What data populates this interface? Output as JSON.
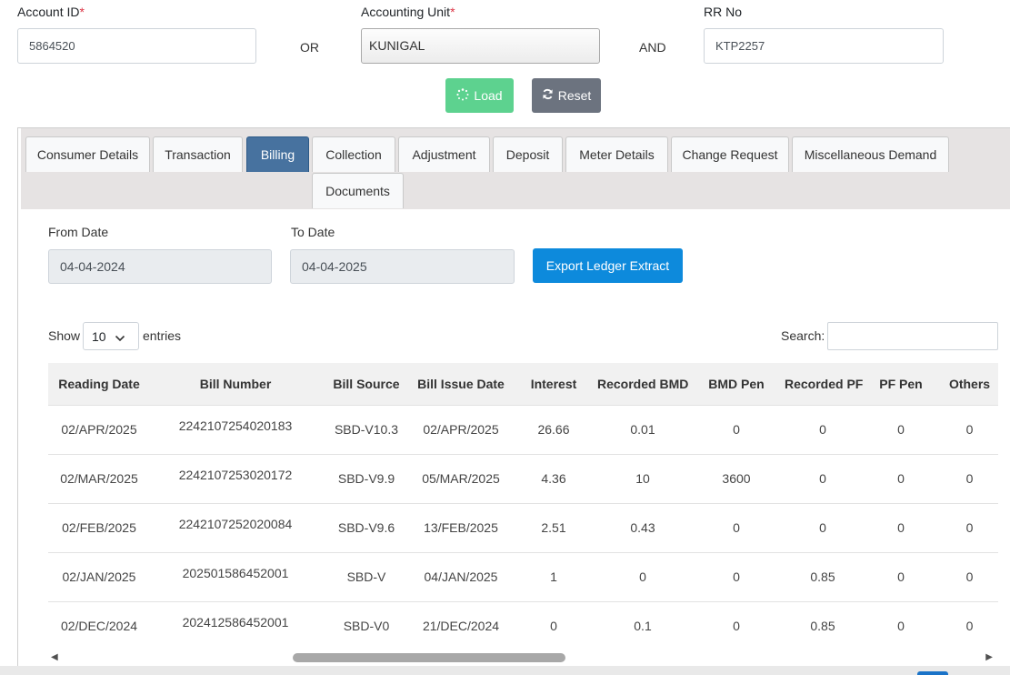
{
  "search_form": {
    "account_id_label": "Account ID",
    "account_id_value": "5864520",
    "or_text": "OR",
    "accounting_unit_label": "Accounting Unit",
    "accounting_unit_value": "KUNIGAL",
    "and_text": "AND",
    "rr_no_label": "RR No",
    "rr_no_value": "KTP2257",
    "required_mark": "*",
    "load_label": "Load",
    "reset_label": "Reset"
  },
  "tabs": [
    {
      "label": "Consumer Details",
      "active": false
    },
    {
      "label": "Transaction",
      "active": false
    },
    {
      "label": "Billing",
      "active": true
    },
    {
      "label": "Collection",
      "active": false
    },
    {
      "label": "Adjustment",
      "active": false
    },
    {
      "label": "Deposit",
      "active": false
    },
    {
      "label": "Meter Details",
      "active": false
    },
    {
      "label": "Change Request",
      "active": false
    },
    {
      "label": "Miscellaneous Demand",
      "active": false
    },
    {
      "label": "Documents",
      "active": false
    }
  ],
  "billing": {
    "from_date_label": "From Date",
    "from_date_value": "04-04-2024",
    "to_date_label": "To Date",
    "to_date_value": "04-04-2025",
    "export_label": "Export Ledger Extract",
    "show_label": "Show",
    "entries_value": "10",
    "entries_label": "entries",
    "search_label": "Search:"
  },
  "table": {
    "columns": [
      "Reading Date",
      "Bill Number",
      "Bill Source",
      "Bill Issue Date",
      "Interest",
      "Recorded BMD",
      "BMD Pen",
      "Recorded PF",
      "PF Pen",
      "Others"
    ],
    "rows": [
      [
        "02/APR/2025",
        "2242107254020183",
        "SBD-V10.3",
        "02/APR/2025",
        "26.66",
        "0.01",
        "0",
        "0",
        "0",
        "0"
      ],
      [
        "02/MAR/2025",
        "2242107253020172",
        "SBD-V9.9",
        "05/MAR/2025",
        "4.36",
        "10",
        "3600",
        "0",
        "0",
        "0"
      ],
      [
        "02/FEB/2025",
        "2242107252020084",
        "SBD-V9.6",
        "13/FEB/2025",
        "2.51",
        "0.43",
        "0",
        "0",
        "0",
        "0"
      ],
      [
        "02/JAN/2025",
        "202501586452001",
        "SBD-V",
        "04/JAN/2025",
        "1",
        "0",
        "0",
        "0.85",
        "0",
        "0"
      ],
      [
        "02/DEC/2024",
        "202412586452001",
        "SBD-V0",
        "21/DEC/2024",
        "0",
        "0.1",
        "0",
        "0.85",
        "0",
        "0"
      ]
    ]
  },
  "colors": {
    "load_button": "#5dd28f",
    "reset_button": "#6c737f",
    "active_tab": "#47729f",
    "export_button": "#0d8adc",
    "required": "#dc3545"
  }
}
